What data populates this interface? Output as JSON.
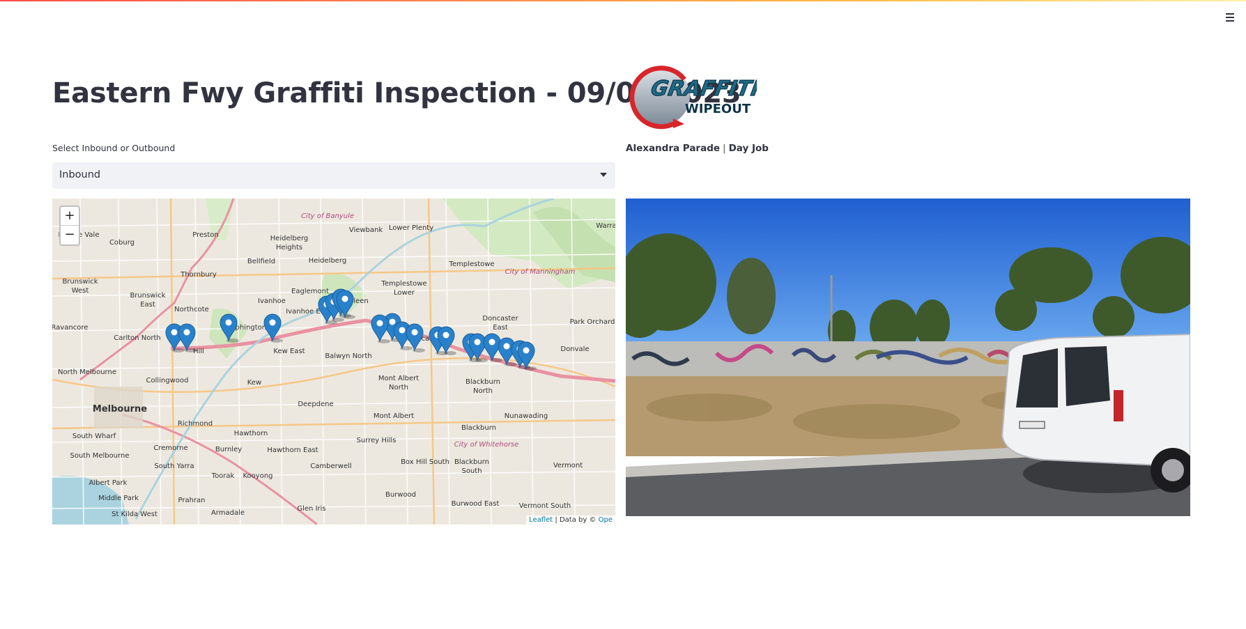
{
  "header": {
    "menu_icon": "hamburger-menu-icon"
  },
  "page": {
    "title": "Eastern Fwy Graffiti Inspection - 09/02/2023"
  },
  "logo": {
    "line1": "GRAFFITI",
    "line2": "WIPEOUT"
  },
  "direction_select": {
    "label": "Select Inbound or Outbound",
    "value": "Inbound"
  },
  "caption": {
    "location": "Alexandra Parade",
    "separator": "|",
    "job": "Day Job"
  },
  "map": {
    "zoom_in": "+",
    "zoom_out": "−",
    "attribution": {
      "leaflet": "Leaflet",
      "text": " | Data by © ",
      "osm": "Ope"
    },
    "place_labels": [
      "Preston",
      "Coburg",
      "Pascoe Vale",
      "Heidelberg Heights",
      "Heidelberg",
      "Bellfield",
      "Viewbank",
      "Lower Plenty",
      "Templestowe",
      "Templestowe Lower",
      "City of Banyule",
      "City of Manningham",
      "Brunswick West",
      "Brunswick East",
      "Thornbury",
      "Northcote",
      "Ivanhoe",
      "Ivanhoe East",
      "Eaglemont",
      "Bulleen",
      "Alphington",
      "Kew East",
      "Carlton North",
      "Doncaster",
      "Doncaster East",
      "Park Orchard",
      "Donvale",
      "Balwyn North",
      "North Melbourne",
      "Collingwood",
      "Kew",
      "Mont Albert North",
      "Blackburn North",
      "Deepdene",
      "Mont Albert",
      "Nunawading",
      "Melbourne",
      "Richmond",
      "Hawthorn",
      "Surrey Hills",
      "Blackburn",
      "City of Whitehorse",
      "South Wharf",
      "Cremorne",
      "Burnley",
      "Hawthorn East",
      "South Melbourne",
      "South Yarra",
      "Toorak",
      "Kooyong",
      "Camberwell",
      "Box Hill South",
      "Blackburn South",
      "Vermont",
      "Albert Park",
      "Middle Park",
      "Prahran",
      "Glen Iris",
      "Burwood",
      "Burwood East",
      "Vermont South",
      "St Kilda West",
      "Armadale",
      "Warrandyte",
      "Ravancore",
      "Hill"
    ],
    "marker_count": 20
  }
}
